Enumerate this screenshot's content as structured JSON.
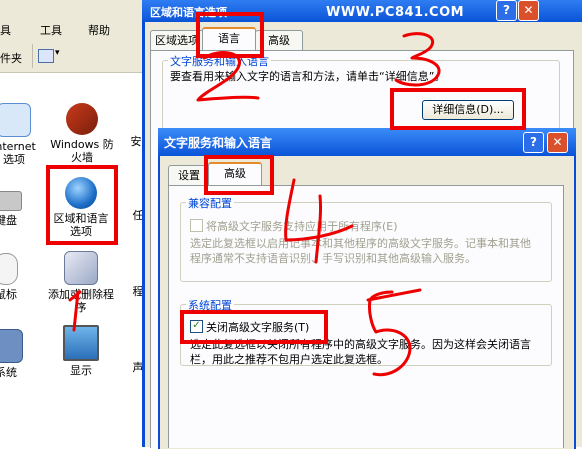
{
  "control_panel": {
    "menu": {
      "tools": "工具",
      "help": "帮助"
    },
    "menu_tail_left": "具",
    "toolbar": {
      "folder": "件夹"
    },
    "items": [
      {
        "label": "Internet 选项",
        "icon": "internet-options-icon"
      },
      {
        "label": "Windows 防火墙",
        "icon": "firewall-icon"
      },
      {
        "label": "安",
        "icon": "security-center-icon"
      },
      {
        "label": "键盘",
        "icon": "keyboard-icon"
      },
      {
        "label": "区域和语言选项",
        "icon": "globe-icon"
      },
      {
        "label": "任",
        "icon": "taskbar-icon"
      },
      {
        "label": "鼠标",
        "icon": "mouse-icon"
      },
      {
        "label": "添加或删除程序",
        "icon": "add-remove-programs-icon"
      },
      {
        "label": "程",
        "icon": "program-icon"
      },
      {
        "label": "系统",
        "icon": "system-icon"
      },
      {
        "label": "显示",
        "icon": "display-icon"
      },
      {
        "label": "声",
        "icon": "sound-icon"
      }
    ]
  },
  "regional_window": {
    "title": "区域和语言选项",
    "watermark": "WWW.PC841.COM",
    "tabs": [
      {
        "label": "区域选项",
        "active": false
      },
      {
        "label": "语言",
        "active": true
      },
      {
        "label": "高级",
        "active": false
      }
    ],
    "group_legend": "文字服务和输入语言",
    "description": "要查看用来输入文字的语言和方法，请单击“详细信息”。",
    "details_button": "详细信息(D)..."
  },
  "text_services_dialog": {
    "title": "文字服务和输入语言",
    "help_glyph": "?",
    "close_glyph": "✕",
    "tabs": [
      {
        "label": "设置",
        "active": false
      },
      {
        "label": "高级",
        "active": true
      }
    ],
    "compat_group": {
      "legend": "兼容配置",
      "checkbox_label": "将高级文字服务支持应用于所有程序(E)",
      "checked": false,
      "disabled": true,
      "description": "选定此复选框以启用记事本和其他程序的高级文字服务。记事本和其他程序通常不支持语音识别、手写识别和其他高级输入服务。"
    },
    "system_group": {
      "legend": "系统配置",
      "checkbox_label": "关闭高级文字服务(T)",
      "checked": true,
      "description": "选定此复选框以关闭所有程序中的高级文字服务。因为这样会关闭语言栏，用此之推荐不包用户选定此复选框。"
    }
  },
  "annotations": {
    "step_numbers": [
      "1",
      "2",
      "3",
      "4",
      "5"
    ],
    "color": "#ee0000"
  }
}
